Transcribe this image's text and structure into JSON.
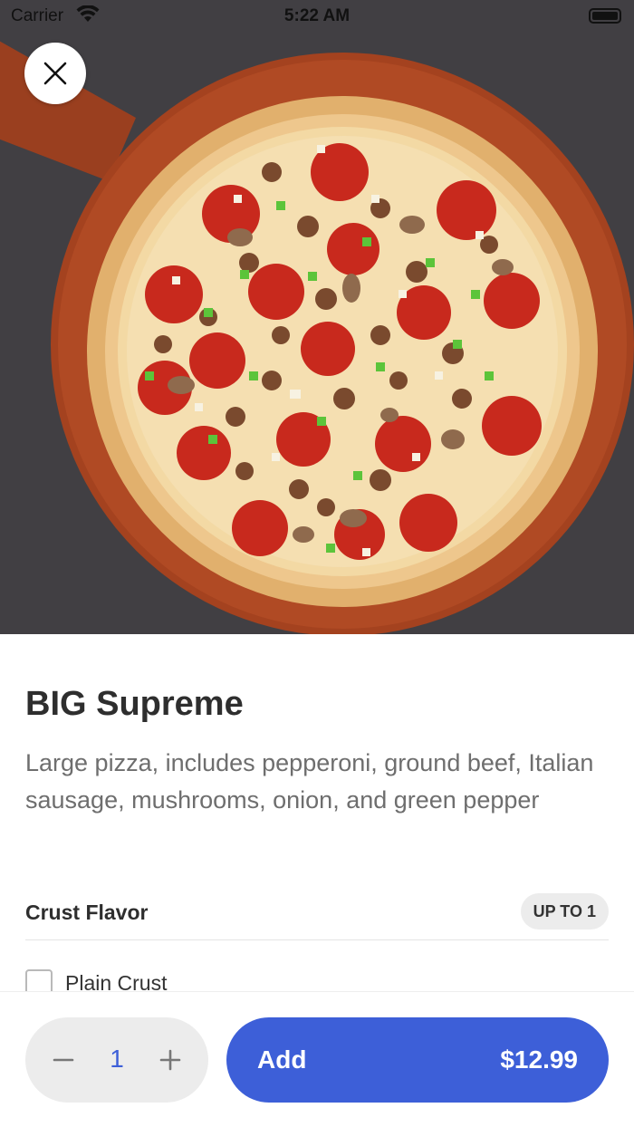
{
  "status_bar": {
    "carrier": "Carrier",
    "time": "5:22 AM"
  },
  "hero": {
    "image": "pizza-photo"
  },
  "item": {
    "title": "BIG Supreme",
    "description": "Large pizza, includes pepperoni, ground beef, Italian sausage, mushrooms, onion, and green pepper"
  },
  "modifier_group": {
    "title": "Crust Flavor",
    "limit": "UP TO 1",
    "options": [
      {
        "label": "Plain Crust",
        "checked": false
      }
    ]
  },
  "cart": {
    "quantity": "1",
    "add_label": "Add",
    "price": "$12.99"
  },
  "colors": {
    "accent": "#3d5fd8",
    "background": "#ffffff",
    "muted_text": "#6e6e6e",
    "stepper_bg": "#ececec"
  }
}
